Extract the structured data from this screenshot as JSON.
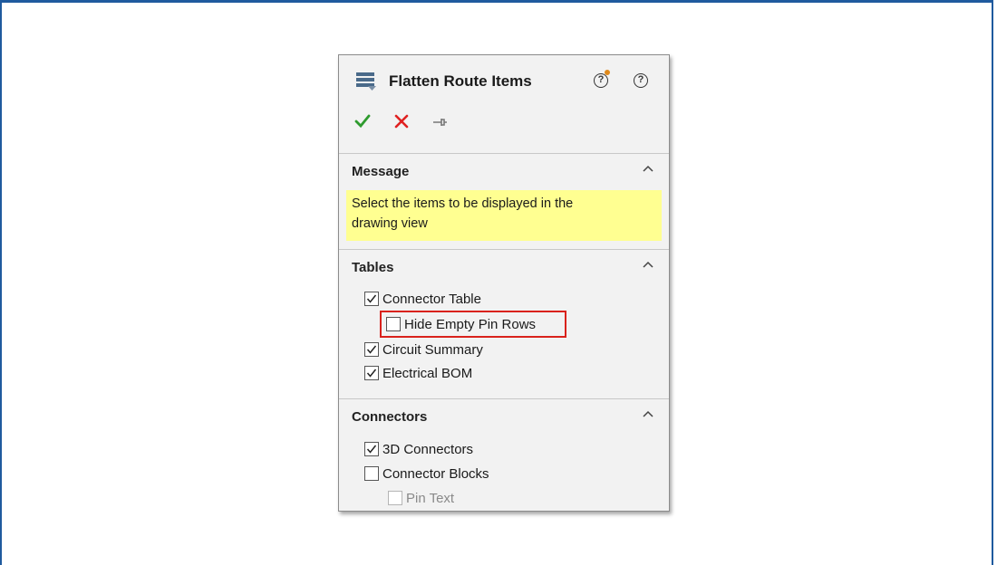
{
  "panel": {
    "title": "Flatten Route Items",
    "icons": {
      "title": "flatten-route-icon",
      "whats_wrong": "whats-wrong-help-icon",
      "help": "help-icon"
    },
    "actions": {
      "ok": "ok-check-icon",
      "cancel": "cancel-x-icon",
      "pin": "pushpin-icon"
    },
    "colors": {
      "ok": "#2e9b2e",
      "cancel": "#e02020",
      "message_bg": "#ffff91",
      "highlight": "#d9221c"
    }
  },
  "message": {
    "header": "Message",
    "text_line1": "Select the items to be displayed in the",
    "text_line2": "drawing view"
  },
  "tables": {
    "header": "Tables",
    "items": [
      {
        "label": "Connector Table",
        "checked": true
      },
      {
        "label": "Hide Empty Pin Rows",
        "checked": false
      },
      {
        "label": "Circuit Summary",
        "checked": true
      },
      {
        "label": "Electrical BOM",
        "checked": true
      }
    ]
  },
  "connectors": {
    "header": "Connectors",
    "items": [
      {
        "label": "3D Connectors",
        "checked": true
      },
      {
        "label": "Connector Blocks",
        "checked": false
      },
      {
        "label": "Pin Text",
        "checked": false,
        "disabled": true
      }
    ]
  }
}
